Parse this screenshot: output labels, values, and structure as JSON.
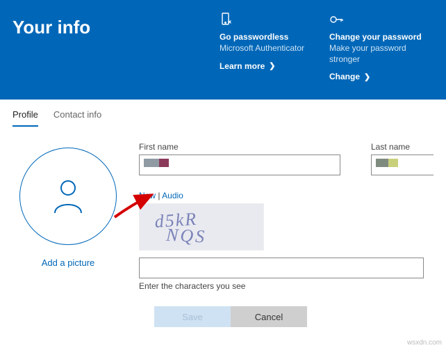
{
  "header": {
    "title": "Your info",
    "cards": {
      "passwordless": {
        "title": "Go passwordless",
        "subtitle": "Microsoft Authenticator",
        "link": "Learn more"
      },
      "changepw": {
        "title": "Change your password",
        "subtitle": "Make your password stronger",
        "link": "Change"
      }
    }
  },
  "tabs": {
    "profile": "Profile",
    "contact": "Contact info"
  },
  "avatar": {
    "add_picture": "Add a picture"
  },
  "form": {
    "first_name_label": "First name",
    "last_name_label": "Last name",
    "captcha": {
      "new": "New",
      "sep": " | ",
      "audio": "Audio",
      "text": "d5kR NQS",
      "hint": "Enter the characters you see"
    },
    "buttons": {
      "save": "Save",
      "cancel": "Cancel"
    }
  },
  "watermark": "wsxdn.com"
}
